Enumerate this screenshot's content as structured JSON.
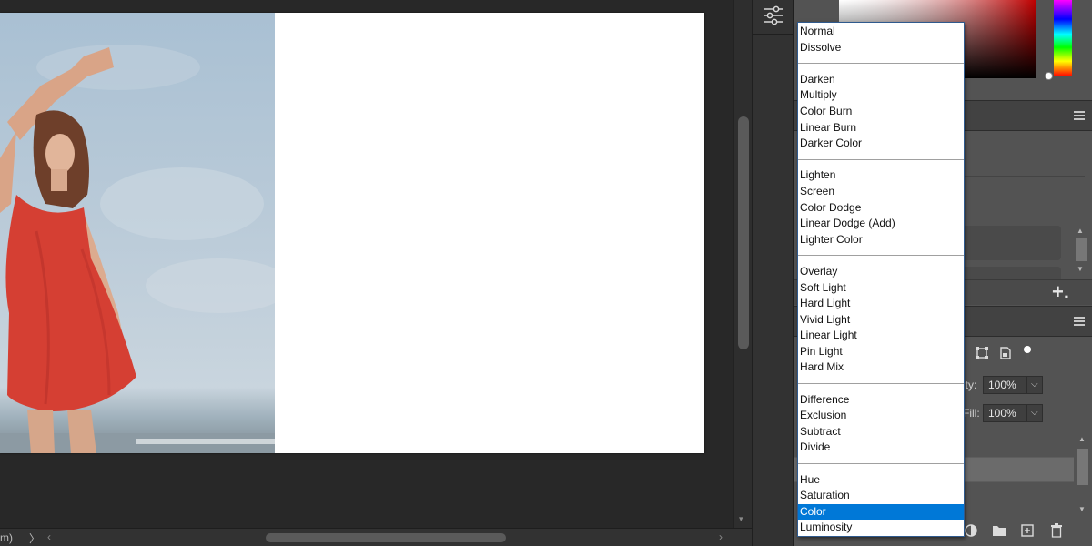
{
  "status": {
    "zoom_fragment": "m)",
    "expand_chevron": "〉",
    "scroll_left": "‹",
    "scroll_right": "›",
    "scroll_down": "▾"
  },
  "toolcol": {
    "adjust_icon": "sliders-icon"
  },
  "blend_modes": {
    "groups": [
      [
        "Normal",
        "Dissolve"
      ],
      [
        "Darken",
        "Multiply",
        "Color Burn",
        "Linear Burn",
        "Darker Color"
      ],
      [
        "Lighten",
        "Screen",
        "Color Dodge",
        "Linear Dodge (Add)",
        "Lighter Color"
      ],
      [
        "Overlay",
        "Soft Light",
        "Hard Light",
        "Vivid Light",
        "Linear Light",
        "Pin Light",
        "Hard Mix"
      ],
      [
        "Difference",
        "Exclusion",
        "Subtract",
        "Divide"
      ],
      [
        "Hue",
        "Saturation",
        "Color",
        "Luminosity"
      ]
    ],
    "selected": "Color"
  },
  "layers": {
    "opacity_label": "ity:",
    "opacity_value": "100%",
    "fill_label": "Fill:",
    "fill_value": "100%",
    "dropdown_glyph": "⌵"
  },
  "properties": {
    "add_glyph": "+."
  },
  "colors": {
    "selected_blue": "#0078d7",
    "panel_bg": "#535353",
    "app_bg": "#282828"
  }
}
